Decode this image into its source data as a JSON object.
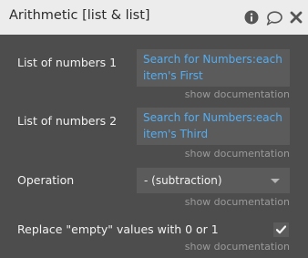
{
  "header": {
    "title": "Arithmetic [list & list]",
    "icons": [
      "info-icon",
      "comment-icon",
      "close-icon"
    ]
  },
  "fields": [
    {
      "label": "List of numbers 1",
      "value": "Search for Numbers:each item's First",
      "doc_link": "show documentation"
    },
    {
      "label": "List of numbers 2",
      "value": "Search for Numbers:each item's Third",
      "doc_link": "show documentation"
    },
    {
      "label": "Operation",
      "selected": "- (subtraction)",
      "doc_link": "show documentation"
    },
    {
      "label": "Replace \"empty\" values with 0 or 1",
      "checked": true,
      "doc_link": "show documentation"
    }
  ],
  "colors": {
    "panel_bg": "#4d4d4d",
    "header_bg": "#ececec",
    "expression_text": "#55adf0"
  }
}
